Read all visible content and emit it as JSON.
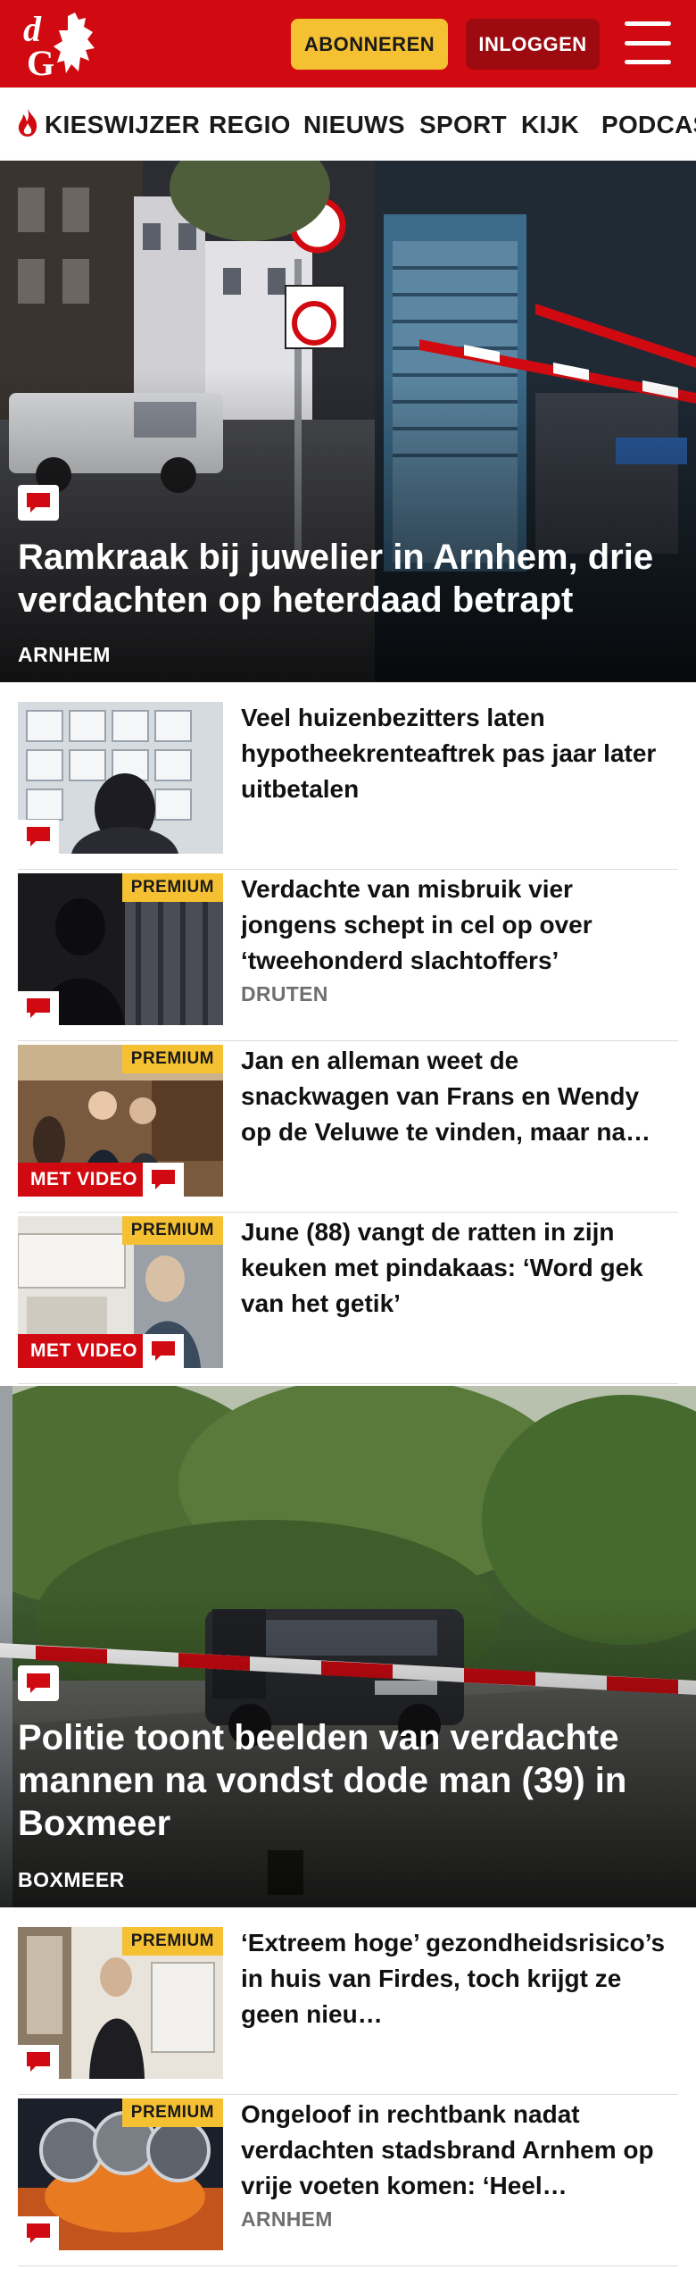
{
  "header": {
    "logo_text": "dG",
    "subscribe_label": "ABONNEREN",
    "login_label": "INLOGGEN",
    "menu_icon": "hamburger-menu-icon",
    "brand_color": "#d10a11",
    "accent_color": "#f5c132"
  },
  "nav": {
    "items": [
      "KIESWIJZER",
      "REGIO",
      "NIEUWS",
      "SPORT",
      "KIJK",
      "PODCASTS"
    ],
    "first_item_icon": "flame-icon"
  },
  "articles": {
    "hero1": {
      "title": "Ramkraak bij juwelier in Arnhem, drie verdachten op heterdaad betrapt",
      "location": "ARNHEM"
    },
    "list1": [
      {
        "title": "Veel huizenbezitters laten hypotheekrenteaftrek pas jaar later uitbetalen",
        "location": "",
        "premium": "",
        "video": ""
      },
      {
        "title": "Verdachte van misbruik vier jongens schept in cel op over ‘tweehonderd slachtoffers’",
        "location": "DRUTEN",
        "premium": "PREMIUM",
        "video": ""
      },
      {
        "title": "Jan en alleman weet de snackwagen van Frans en Wendy op de Veluwe te vinden, maar na…",
        "location": "",
        "premium": "PREMIUM",
        "video": "MET VIDEO"
      },
      {
        "title": "June (88) vangt de ratten in zijn keuken met pindakaas: ‘Word gek van het getik’",
        "location": "",
        "premium": "PREMIUM",
        "video": "MET VIDEO"
      }
    ],
    "hero2": {
      "title": "Politie toont beelden van verdachte mannen na vondst dode man (39) in Boxmeer",
      "location": "BOXMEER"
    },
    "list2": [
      {
        "title": "‘Extreem hoge’ gezondheidsrisico’s in huis van Firdes, toch krijgt ze geen nieu…",
        "location": "",
        "premium": "PREMIUM",
        "video": ""
      },
      {
        "title": "Ongeloof in rechtbank nadat verdachten stadsbrand Arnhem op vrije voeten komen: ‘Heel…",
        "location": "ARNHEM",
        "premium": "PREMIUM",
        "video": ""
      }
    ]
  }
}
